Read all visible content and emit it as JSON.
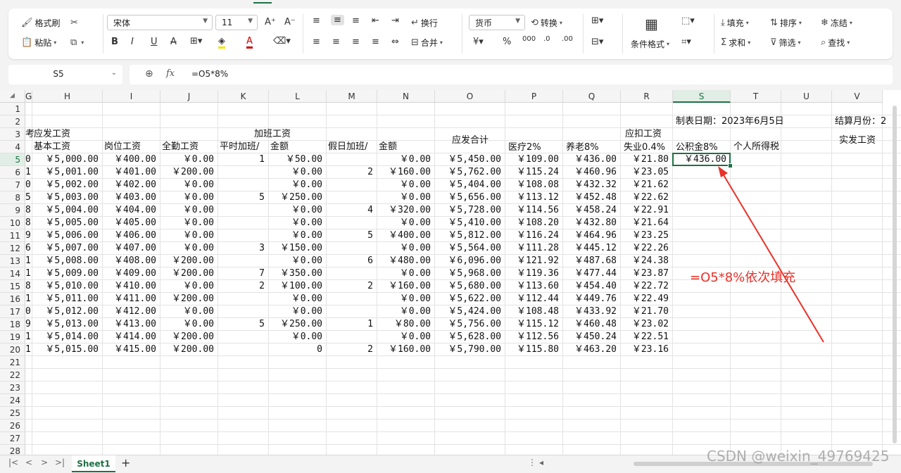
{
  "ribbon": {
    "format_painter": "格式刷",
    "paste": "粘贴",
    "font_name": "宋体",
    "font_size": "11",
    "wrap": "换行",
    "merge": "合并",
    "number_format": "货币",
    "convert": "转换",
    "conditional_format": "条件格式",
    "fill": "填充",
    "sort": "排序",
    "freeze": "冻结",
    "sum": "求和",
    "filter": "筛选",
    "find": "查找"
  },
  "formula_bar": {
    "name_box": "S5",
    "fx": "fx",
    "formula": "=O5*8%"
  },
  "columns": [
    "G",
    "H",
    "I",
    "J",
    "K",
    "L",
    "M",
    "N",
    "O",
    "P",
    "Q",
    "R",
    "S",
    "T",
    "U",
    "V"
  ],
  "rows": [
    "1",
    "2",
    "3",
    "4",
    "5",
    "6",
    "7",
    "8",
    "9",
    "10",
    "11",
    "12",
    "13",
    "14",
    "15",
    "16",
    "17",
    "18",
    "19",
    "20",
    "21",
    "22",
    "23",
    "24",
    "25",
    "26",
    "27",
    "28"
  ],
  "selected_cell": "S5",
  "headers": {
    "date_label": "制表日期：2023年6月5日",
    "month_label": "结算月份：2",
    "g3": "考",
    "should_pay": "应发工资",
    "overtime": "加班工资",
    "total": "应发合计",
    "deduct": "应扣工资",
    "net_pay": "实发工资",
    "base": "基本工资",
    "position": "岗位工资",
    "attendance": "全勤工资",
    "ot_normal": "平时加班/",
    "amount1": "金额",
    "ot_holiday": "假日加班/",
    "amount2": "金额",
    "medical": "医疗2%",
    "pension": "养老8%",
    "unemployment": "失业0.4%",
    "fund": "公积金8%",
    "tax": "个人所得税"
  },
  "data_rows": [
    {
      "g": "0",
      "h": "￥5,000.00",
      "i": "￥400.00",
      "j": "￥0.00",
      "k": "1",
      "l": "￥50.00",
      "m": "",
      "n": "￥0.00",
      "o": "￥5,450.00",
      "p": "￥109.00",
      "q": "￥436.00",
      "r": "￥21.80",
      "s": "￥436.00"
    },
    {
      "g": "1",
      "h": "￥5,001.00",
      "i": "￥401.00",
      "j": "￥200.00",
      "k": "",
      "l": "￥0.00",
      "m": "2",
      "n": "￥160.00",
      "o": "￥5,762.00",
      "p": "￥115.24",
      "q": "￥460.96",
      "r": "￥23.05",
      "s": ""
    },
    {
      "g": "0",
      "h": "￥5,002.00",
      "i": "￥402.00",
      "j": "￥0.00",
      "k": "",
      "l": "￥0.00",
      "m": "",
      "n": "￥0.00",
      "o": "￥5,404.00",
      "p": "￥108.08",
      "q": "￥432.32",
      "r": "￥21.62",
      "s": ""
    },
    {
      "g": "5",
      "h": "￥5,003.00",
      "i": "￥403.00",
      "j": "￥0.00",
      "k": "5",
      "l": "￥250.00",
      "m": "",
      "n": "￥0.00",
      "o": "￥5,656.00",
      "p": "￥113.12",
      "q": "￥452.48",
      "r": "￥22.62",
      "s": ""
    },
    {
      "g": "8",
      "h": "￥5,004.00",
      "i": "￥404.00",
      "j": "￥0.00",
      "k": "",
      "l": "￥0.00",
      "m": "4",
      "n": "￥320.00",
      "o": "￥5,728.00",
      "p": "￥114.56",
      "q": "￥458.24",
      "r": "￥22.91",
      "s": ""
    },
    {
      "g": "8",
      "h": "￥5,005.00",
      "i": "￥405.00",
      "j": "￥0.00",
      "k": "",
      "l": "￥0.00",
      "m": "",
      "n": "￥0.00",
      "o": "￥5,410.00",
      "p": "￥108.20",
      "q": "￥432.80",
      "r": "￥21.64",
      "s": ""
    },
    {
      "g": "9",
      "h": "￥5,006.00",
      "i": "￥406.00",
      "j": "￥0.00",
      "k": "",
      "l": "￥0.00",
      "m": "5",
      "n": "￥400.00",
      "o": "￥5,812.00",
      "p": "￥116.24",
      "q": "￥464.96",
      "r": "￥23.25",
      "s": ""
    },
    {
      "g": "6",
      "h": "￥5,007.00",
      "i": "￥407.00",
      "j": "￥0.00",
      "k": "3",
      "l": "￥150.00",
      "m": "",
      "n": "￥0.00",
      "o": "￥5,564.00",
      "p": "￥111.28",
      "q": "￥445.12",
      "r": "￥22.26",
      "s": ""
    },
    {
      "g": "1",
      "h": "￥5,008.00",
      "i": "￥408.00",
      "j": "￥200.00",
      "k": "",
      "l": "￥0.00",
      "m": "6",
      "n": "￥480.00",
      "o": "￥6,096.00",
      "p": "￥121.92",
      "q": "￥487.68",
      "r": "￥24.38",
      "s": ""
    },
    {
      "g": "1",
      "h": "￥5,009.00",
      "i": "￥409.00",
      "j": "￥200.00",
      "k": "7",
      "l": "￥350.00",
      "m": "",
      "n": "￥0.00",
      "o": "￥5,968.00",
      "p": "￥119.36",
      "q": "￥477.44",
      "r": "￥23.87",
      "s": ""
    },
    {
      "g": "8",
      "h": "￥5,010.00",
      "i": "￥410.00",
      "j": "￥0.00",
      "k": "2",
      "l": "￥100.00",
      "m": "2",
      "n": "￥160.00",
      "o": "￥5,680.00",
      "p": "￥113.60",
      "q": "￥454.40",
      "r": "￥22.72",
      "s": ""
    },
    {
      "g": "1",
      "h": "￥5,011.00",
      "i": "￥411.00",
      "j": "￥200.00",
      "k": "",
      "l": "￥0.00",
      "m": "",
      "n": "￥0.00",
      "o": "￥5,622.00",
      "p": "￥112.44",
      "q": "￥449.76",
      "r": "￥22.49",
      "s": ""
    },
    {
      "g": "0",
      "h": "￥5,012.00",
      "i": "￥412.00",
      "j": "￥0.00",
      "k": "",
      "l": "￥0.00",
      "m": "",
      "n": "￥0.00",
      "o": "￥5,424.00",
      "p": "￥108.48",
      "q": "￥433.92",
      "r": "￥21.70",
      "s": ""
    },
    {
      "g": "9",
      "h": "￥5,013.00",
      "i": "￥413.00",
      "j": "￥0.00",
      "k": "5",
      "l": "￥250.00",
      "m": "1",
      "n": "￥80.00",
      "o": "￥5,756.00",
      "p": "￥115.12",
      "q": "￥460.48",
      "r": "￥23.02",
      "s": ""
    },
    {
      "g": "1",
      "h": "￥5,014.00",
      "i": "￥414.00",
      "j": "￥200.00",
      "k": "",
      "l": "￥0.00",
      "m": "",
      "n": "￥0.00",
      "o": "￥5,628.00",
      "p": "￥112.56",
      "q": "￥450.24",
      "r": "￥22.51",
      "s": ""
    },
    {
      "g": "1",
      "h": "￥5,015.00",
      "i": "￥415.00",
      "j": "￥200.00",
      "k": "",
      "l": "0",
      "m": "2",
      "n": "￥160.00",
      "o": "￥5,790.00",
      "p": "￥115.80",
      "q": "￥463.20",
      "r": "￥23.16",
      "s": ""
    }
  ],
  "annotation": "=O5*8%依次填充",
  "sheet_tab": "Sheet1",
  "add_sheet": "+",
  "watermark": "CSDN @weixin_49769425",
  "colors": {
    "accent": "#1e7145",
    "annotation": "#e8322a"
  }
}
